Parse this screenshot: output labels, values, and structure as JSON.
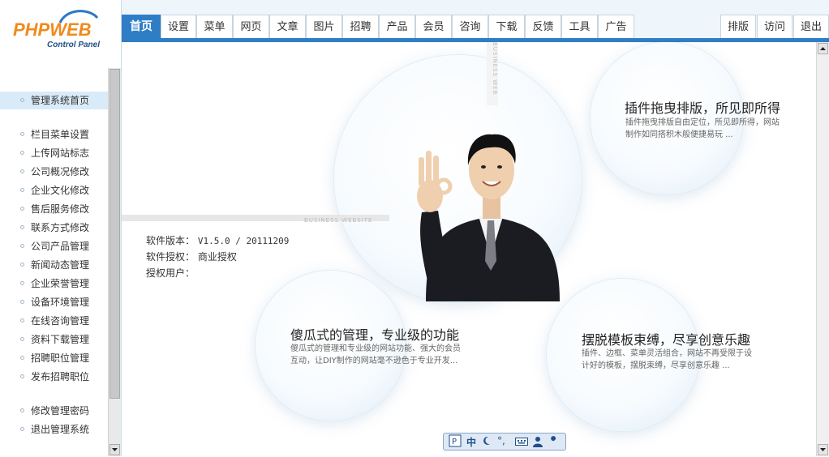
{
  "logo": {
    "brand_main": "PHPWEB",
    "brand_sub": "Control Panel"
  },
  "nav": {
    "tabs": [
      "首页",
      "设置",
      "菜单",
      "网页",
      "文章",
      "图片",
      "招聘",
      "产品",
      "会员",
      "咨询",
      "下载",
      "反馈",
      "工具",
      "广告"
    ],
    "active_tab": "首页",
    "right_tabs": [
      "排版",
      "访问",
      "退出"
    ]
  },
  "sidebar": {
    "groups": [
      [
        "管理系统首页"
      ],
      [
        "栏目菜单设置",
        "上传网站标志",
        "公司概况修改",
        "企业文化修改",
        "售后服务修改",
        "联系方式修改",
        "公司产品管理",
        "新闻动态管理",
        "企业荣誉管理",
        "设备环境管理",
        "在线咨询管理",
        "资料下载管理",
        "招聘职位管理",
        "发布招聘职位"
      ],
      [
        "修改管理密码",
        "退出管理系统"
      ]
    ],
    "active_item": "管理系统首页"
  },
  "main": {
    "banner_text_top": "BUSINESS WEB",
    "banner_text_band": "BUSINESS WEBSITE",
    "info": {
      "version_label": "软件版本：",
      "version_value": "V1.5.0 / 20111209",
      "license_label": "软件授权：",
      "license_value": "商业授权",
      "user_label": "授权用户："
    },
    "features": [
      {
        "title": "插件拖曳排版，所见即所得",
        "text": "插件拖曳排版自由定位，所见即所得，网站制作如同搭积木般便捷易玩 ..."
      },
      {
        "title": "傻瓜式的管理，专业级的功能",
        "text": "傻瓜式的管理和专业级的网站功能、强大的会员互动，让DIY制作的网站毫不逊色于专业开发..."
      },
      {
        "title": "摆脱模板束缚，尽享创意乐趣",
        "text": "插件、边框、菜单灵活组合，网站不再受限于设计好的模板，摆脱束缚，尽享创意乐趣 ..."
      }
    ]
  },
  "ime": {
    "mode_label": "中",
    "punct": "°,",
    "icons": [
      "ime-logo-icon",
      "moon-icon",
      "keyboard-icon",
      "user-icon",
      "wrench-icon"
    ]
  },
  "colors": {
    "accent": "#2f7ec5",
    "logo_orange": "#f08a1c",
    "logo_blue": "#1d6fbf",
    "active_side": "#d9ebf8"
  }
}
